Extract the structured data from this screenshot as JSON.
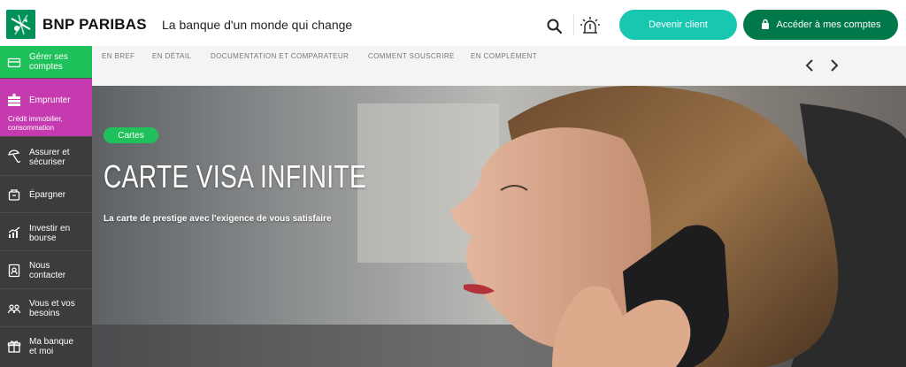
{
  "brand": {
    "name": "BNP PARIBAS",
    "tagline": "La banque d'un monde qui change",
    "colors": {
      "green": "#00915a",
      "dark_green": "#00784a",
      "teal": "#18c7b0",
      "magenta": "#c53aaf",
      "sidebar": "#3c3c3c"
    }
  },
  "header": {
    "search_icon": "search-icon",
    "alert_icon": "alarm-light-icon",
    "become_client_label": "Devenir client",
    "access_accounts_label": "Accéder à mes comptes",
    "lock_icon": "lock-icon"
  },
  "subnav": {
    "items": [
      "EN BREF",
      "EN DÉTAIL",
      "DOCUMENTATION ET COMPARATEUR",
      "COMMENT SOUSCRIRE",
      "EN COMPLÉMENT"
    ],
    "prev_icon": "chevron-left-icon",
    "next_icon": "chevron-right-icon"
  },
  "sidebar": {
    "items": [
      {
        "label": "Gérer ses comptes",
        "icon": "card-icon",
        "color": "#1fc15b"
      },
      {
        "label": "Emprunter",
        "sub": "Crédit immobilier, consommation",
        "icon": "money-stack-icon",
        "color": "#c53aaf"
      },
      {
        "label": "Assurer et sécuriser",
        "icon": "umbrella-icon"
      },
      {
        "label": "Épargner",
        "icon": "piggy-bank-icon"
      },
      {
        "label": "Investir en bourse",
        "icon": "chart-icon"
      },
      {
        "label": "Nous contacter",
        "icon": "contact-icon"
      },
      {
        "label": "Vous et vos besoins",
        "icon": "people-icon"
      },
      {
        "label": "Ma banque et moi",
        "icon": "gift-icon"
      }
    ]
  },
  "hero": {
    "badge": "Cartes",
    "title": "CARTE VISA INFINITE",
    "subtitle": "La carte de prestige avec l'exigence de vous satisfaire"
  }
}
